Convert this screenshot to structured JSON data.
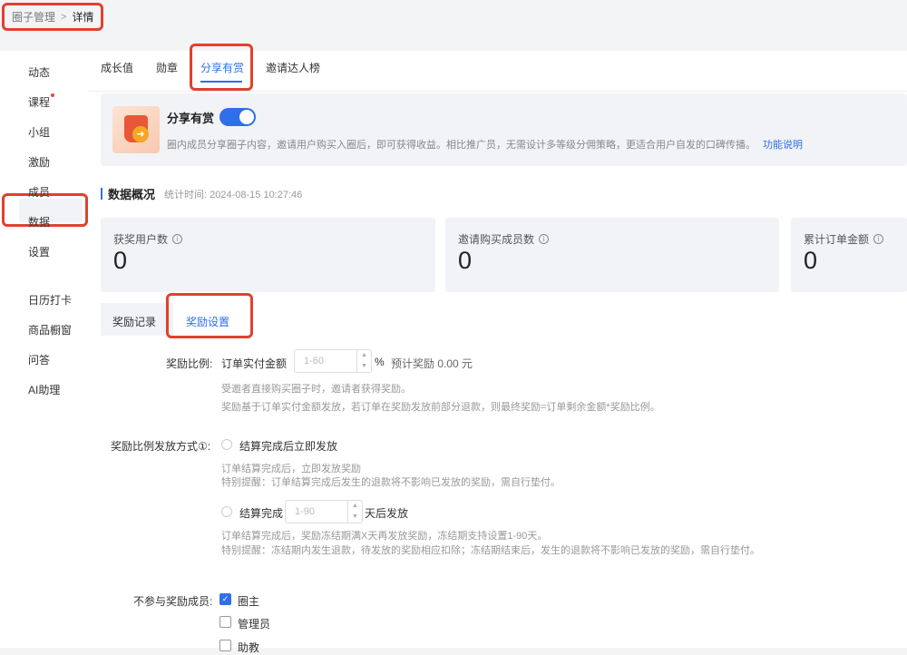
{
  "breadcrumb": {
    "parent": "圈子管理",
    "separator": ">",
    "current": "详情"
  },
  "sidebar": {
    "items": [
      {
        "label": "动态"
      },
      {
        "label": "课程"
      },
      {
        "label": "小组"
      },
      {
        "label": "激励"
      },
      {
        "label": "成员"
      },
      {
        "label": "数据"
      },
      {
        "label": "设置"
      },
      {
        "label": "日历打卡"
      },
      {
        "label": "商品橱窗"
      },
      {
        "label": "问答"
      },
      {
        "label": "AI助理"
      }
    ],
    "active": "激励"
  },
  "tabs": [
    {
      "label": "成长值"
    },
    {
      "label": "勋章"
    },
    {
      "label": "分享有赏"
    },
    {
      "label": "邀请达人榜"
    }
  ],
  "active_tab": "分享有赏",
  "feature": {
    "title": "分享有赏",
    "enabled": true,
    "description": "圈内成员分享圈子内容，邀请用户购买入圈后，即可获得收益。相比推广员，无需设计多等级分佣策略，更适合用户自发的口碑传播。",
    "link": "功能说明"
  },
  "overview": {
    "title": "数据概况",
    "time_label": "统计时间: 2024-08-15 10:27:46",
    "stats": [
      {
        "label": "获奖用户数",
        "value": "0"
      },
      {
        "label": "邀请购买成员数",
        "value": "0"
      },
      {
        "label": "累计订单金额",
        "value": "0"
      }
    ]
  },
  "subtabs": [
    {
      "label": "奖励记录"
    },
    {
      "label": "奖励设置"
    }
  ],
  "active_subtab": "奖励设置",
  "reward_ratio": {
    "label": "奖励比例:",
    "prefix": "订单实付金额",
    "placeholder": "1-60",
    "unit": "%",
    "estimate": "预计奖励 0.00 元",
    "hint1": "受邀者直接购买圈子时，邀请者获得奖励。",
    "hint2": "奖励基于订单实付金额发放，若订单在奖励发放前部分退款，则最终奖励=订单剩余金额*奖励比例。"
  },
  "payout": {
    "label": "奖励比例发放方式①:",
    "option1": "结算完成后立即发放",
    "option1_hint1": "订单结算完成后，立即发放奖励",
    "option1_hint2": "特别提醒：订单结算完成后发生的退款将不影响已发放的奖励，需自行垫付。",
    "option2_prefix": "结算完成",
    "option2_placeholder": "1-90",
    "option2_suffix": "天后发放",
    "option2_hint1": "订单结算完成后，奖励冻结期满X天再发放奖励，冻结期支持设置1-90天。",
    "option2_hint2": "特别提醒：冻结期内发生退款，待发放的奖励相应扣除；冻结期结束后，发生的退款将不影响已发放的奖励，需自行垫付。"
  },
  "excluded": {
    "label": "不参与奖励成员:",
    "options": [
      {
        "label": "圈主",
        "checked": true
      },
      {
        "label": "管理员",
        "checked": false
      },
      {
        "label": "助教",
        "checked": false
      }
    ]
  }
}
